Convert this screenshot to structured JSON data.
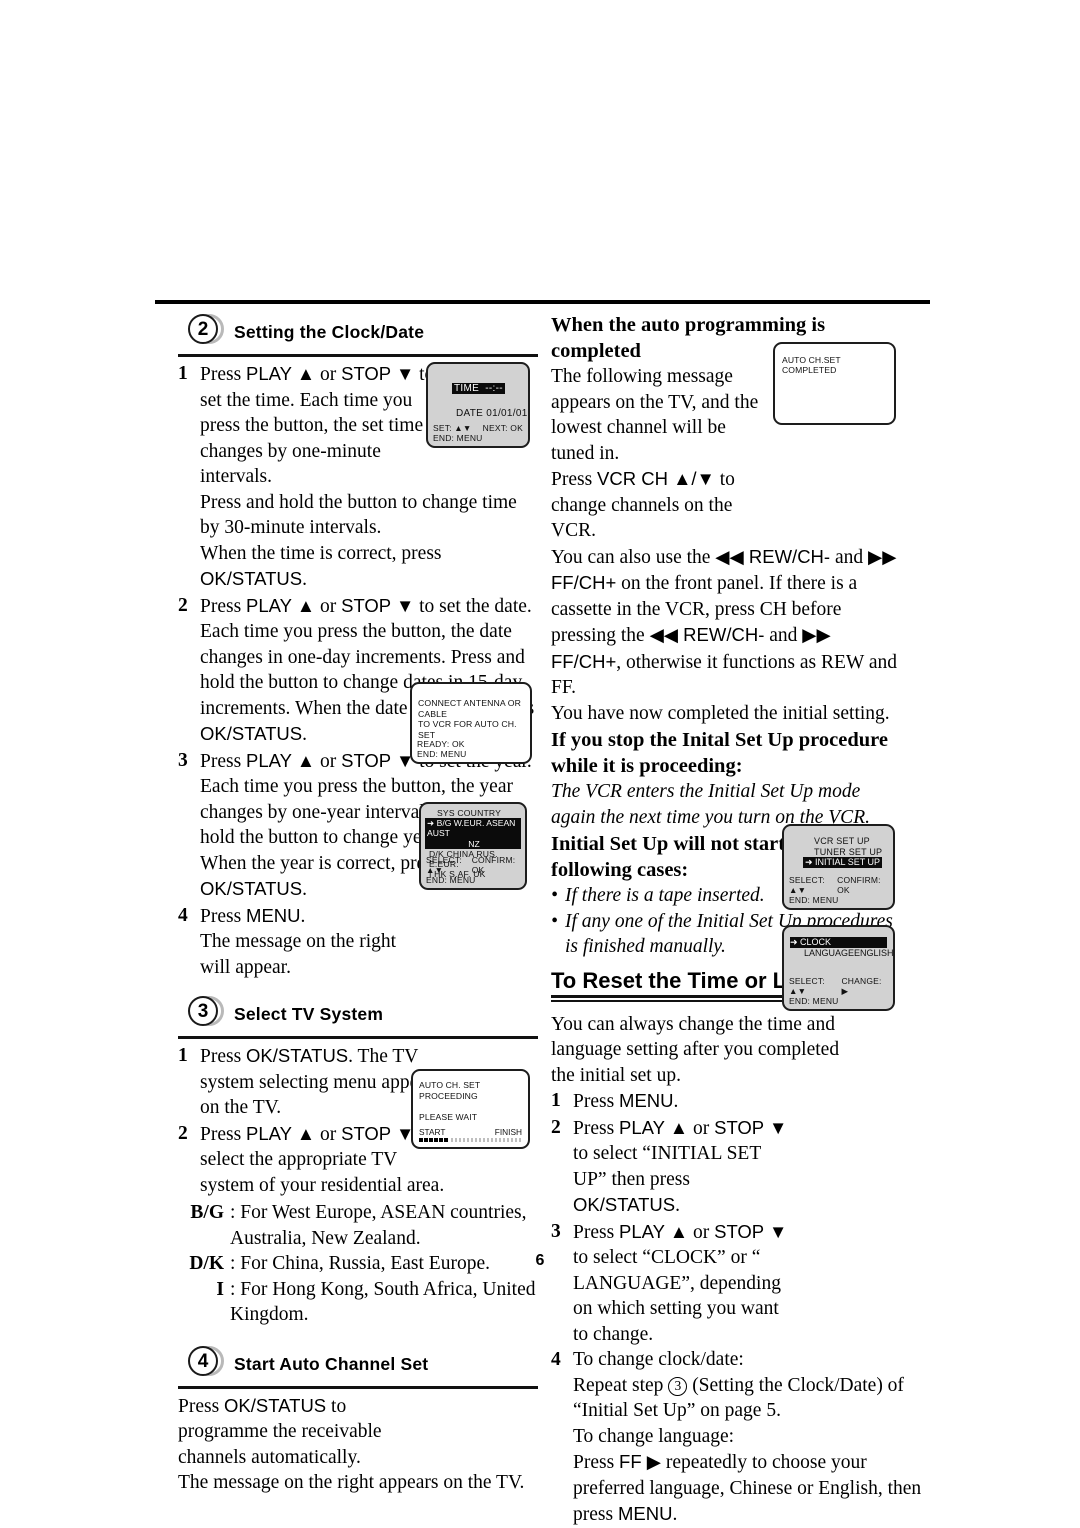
{
  "page": {
    "number": "6"
  },
  "left": {
    "step2": {
      "badge": "2",
      "title": "Setting the Clock/Date",
      "items": [
        {
          "n": "1",
          "pre": "Press ",
          "k1": "PLAY ▲",
          "mid1": " or ",
          "k2": "STOP ▼",
          "post": " to set the time. Each time you press the button, the set time changes by one-minute intervals."
        },
        {
          "line1": "Press and hold the button to change time by 30-minute intervals."
        },
        {
          "line2pre": "When the time is correct, press ",
          "line2key": "OK/STATUS",
          "line2post": "."
        },
        {
          "n": "2",
          "pre": "Press ",
          "k1": "PLAY ▲",
          "mid1": " or ",
          "k2": "STOP ▼",
          "post": " to set the date. Each time you press the button, the date changes in one-day increments.  Press and hold the button to change dates in 15-day increments. When the date is correct, press ",
          "key2": "OK/STATUS",
          "tail": "."
        },
        {
          "n": "3",
          "pre": "Press ",
          "k1": "PLAY ▲",
          "mid1": " or ",
          "k2": "STOP ▼",
          "post": " to set the year. Each time you press the button, the year changes by one-year intervals. Press and hold the button to change years rapidly. When the year is correct, press ",
          "key2": "OK/STATUS",
          "tail": "."
        },
        {
          "n": "4",
          "pre": "Press ",
          "k1": "MENU",
          "post": ".",
          "line2": "The message on the right will appear."
        }
      ]
    },
    "step3": {
      "badge": "3",
      "title": "Select TV System",
      "item1": {
        "n": "1",
        "pre": "Press ",
        "k1": "OK/STATUS",
        "post": ". The TV system selecting menu appears on the TV."
      },
      "item2": {
        "n": "2",
        "pre": "Press ",
        "k1": "PLAY ▲",
        "mid1": " or ",
        "k2": "STOP ▼",
        "post": " to select the appropriate TV system of your residential area."
      },
      "systems": [
        {
          "label": "B/G",
          "text": ": For West Europe, ASEAN countries, Australia, New Zealand."
        },
        {
          "label": "D/K",
          "text": ": For China, Russia, East Europe."
        },
        {
          "label": "I",
          "text": ": For Hong Kong, South Africa, United Kingdom."
        }
      ]
    },
    "step4": {
      "badge": "4",
      "title": "Start Auto Channel Set",
      "pre": "Press ",
      "k1": "OK/STATUS",
      "post": " to programme the receivable channels automatically.",
      "line2": "The message on the right appears on the TV."
    }
  },
  "right": {
    "heading1": "When the auto programming is completed",
    "para1_a": "The following message appears on the TV, and the lowest channel will be tuned in.",
    "para1_b_pre": "Press ",
    "para1_b_key": "VCR CH ▲/▼",
    "para1_b_post": " to change channels on the VCR.",
    "para2_pre": "You can also use the ",
    "para2_k1": "◀◀ REW/CH-",
    "para2_mid": " and ",
    "para2_k2": "▶▶ FF/CH+",
    "para2_post": " on the front panel. If there is a cassette in the VCR, press CH before pressing the ",
    "para2_k3": "◀◀ REW/CH-",
    "para2_mid2": " and ",
    "para2_k4": "▶▶ FF/CH+",
    "para2_tail": ", otherwise it functions as REW and FF.",
    "para3": "You have now completed the initial setting.",
    "heading2": "If you stop the Inital Set Up procedure while it is proceeding:",
    "italic1": "The VCR enters the Initial Set Up mode again the next time you turn on the VCR.",
    "heading3": "Initial Set Up will not start in the following cases:",
    "bullets": [
      "If there is a tape inserted.",
      "If any one of the Initial Set Up procedures is finished manually."
    ],
    "section_heading": "To Reset the Time or Language",
    "intro": "You can always change the time and language setting after you completed the initial set up.",
    "steps": [
      {
        "n": "1",
        "pre": "Press ",
        "k1": "MENU",
        "post": "."
      },
      {
        "n": "2",
        "pre": "Press ",
        "k1": "PLAY ▲",
        "mid1": " or ",
        "k2": "STOP ▼",
        "post": " to select “INITIAL SET UP” then press ",
        "k3": "OK/STATUS",
        "tail": "."
      },
      {
        "n": "3",
        "pre": "Press ",
        "k1": "PLAY ▲",
        "mid1": " or ",
        "k2": "STOP ▼",
        "post": " to select “CLOCK” or “ LANGUAGE”, depending on which setting you want to change."
      },
      {
        "n": "4",
        "l1": "To change clock/date:",
        "l2a": "Repeat step ",
        "l2circ": "3",
        "l2b": " (Setting the Clock/Date) of “Initial Set Up” on page 5.",
        "l3": "To change language:",
        "l4pre": "Press ",
        "l4key": "FF ▶",
        "l4mid": " repeatedly to choose your preferred language, Chinese or English, then press ",
        "l4key2": "MENU",
        "l4tail": "."
      }
    ]
  },
  "screens": {
    "time": {
      "time_label": "TIME",
      "time_value": "--:--",
      "date_label": "DATE",
      "date_value": "01/01/01",
      "foot_left": "SET: ▲▼",
      "foot_right": "NEXT: OK",
      "foot_end": "END: MENU"
    },
    "antenna": {
      "line1": "CONNECT ANTENNA OR CABLE",
      "line2": "TO VCR FOR AUTO CH. SET",
      "foot_left": "READY: OK",
      "foot_end": "END: MENU"
    },
    "sys_country": {
      "title": "SYS COUNTRY",
      "sel_line1": "➜ B/G  W.EUR.  ASEAN  AUST",
      "sel_line2": "NZ",
      "row2": "D/K  CHINA  RUS.  E.EUR.",
      "row3": "I     HK  S.AF.  UK",
      "foot_left": "SELECT: ▲▼",
      "foot_right": "CONFIRM: OK",
      "foot_end": "END: MENU"
    },
    "proceeding": {
      "line1": "AUTO CH. SET PROCEEDING",
      "line2": "PLEASE WAIT",
      "start": "START",
      "finish": "FINISH"
    },
    "completed": {
      "line1": "AUTO CH.SET COMPLETED"
    },
    "vcr_setup": {
      "row1": "VCR SET UP",
      "row2": "TUNER SET UP",
      "row3": "➜ INITIAL SET UP",
      "foot_left": "SELECT: ▲▼",
      "foot_right": "CONFIRM: OK",
      "foot_end": "END: MENU"
    },
    "clock_menu": {
      "row1": "➜ CLOCK",
      "row2_label": "LANGUAGE",
      "row2_value": "ENGLISH",
      "foot_left": "SELECT: ▲▼",
      "foot_right": "CHANGE: ▶",
      "foot_end": "END: MENU"
    }
  }
}
